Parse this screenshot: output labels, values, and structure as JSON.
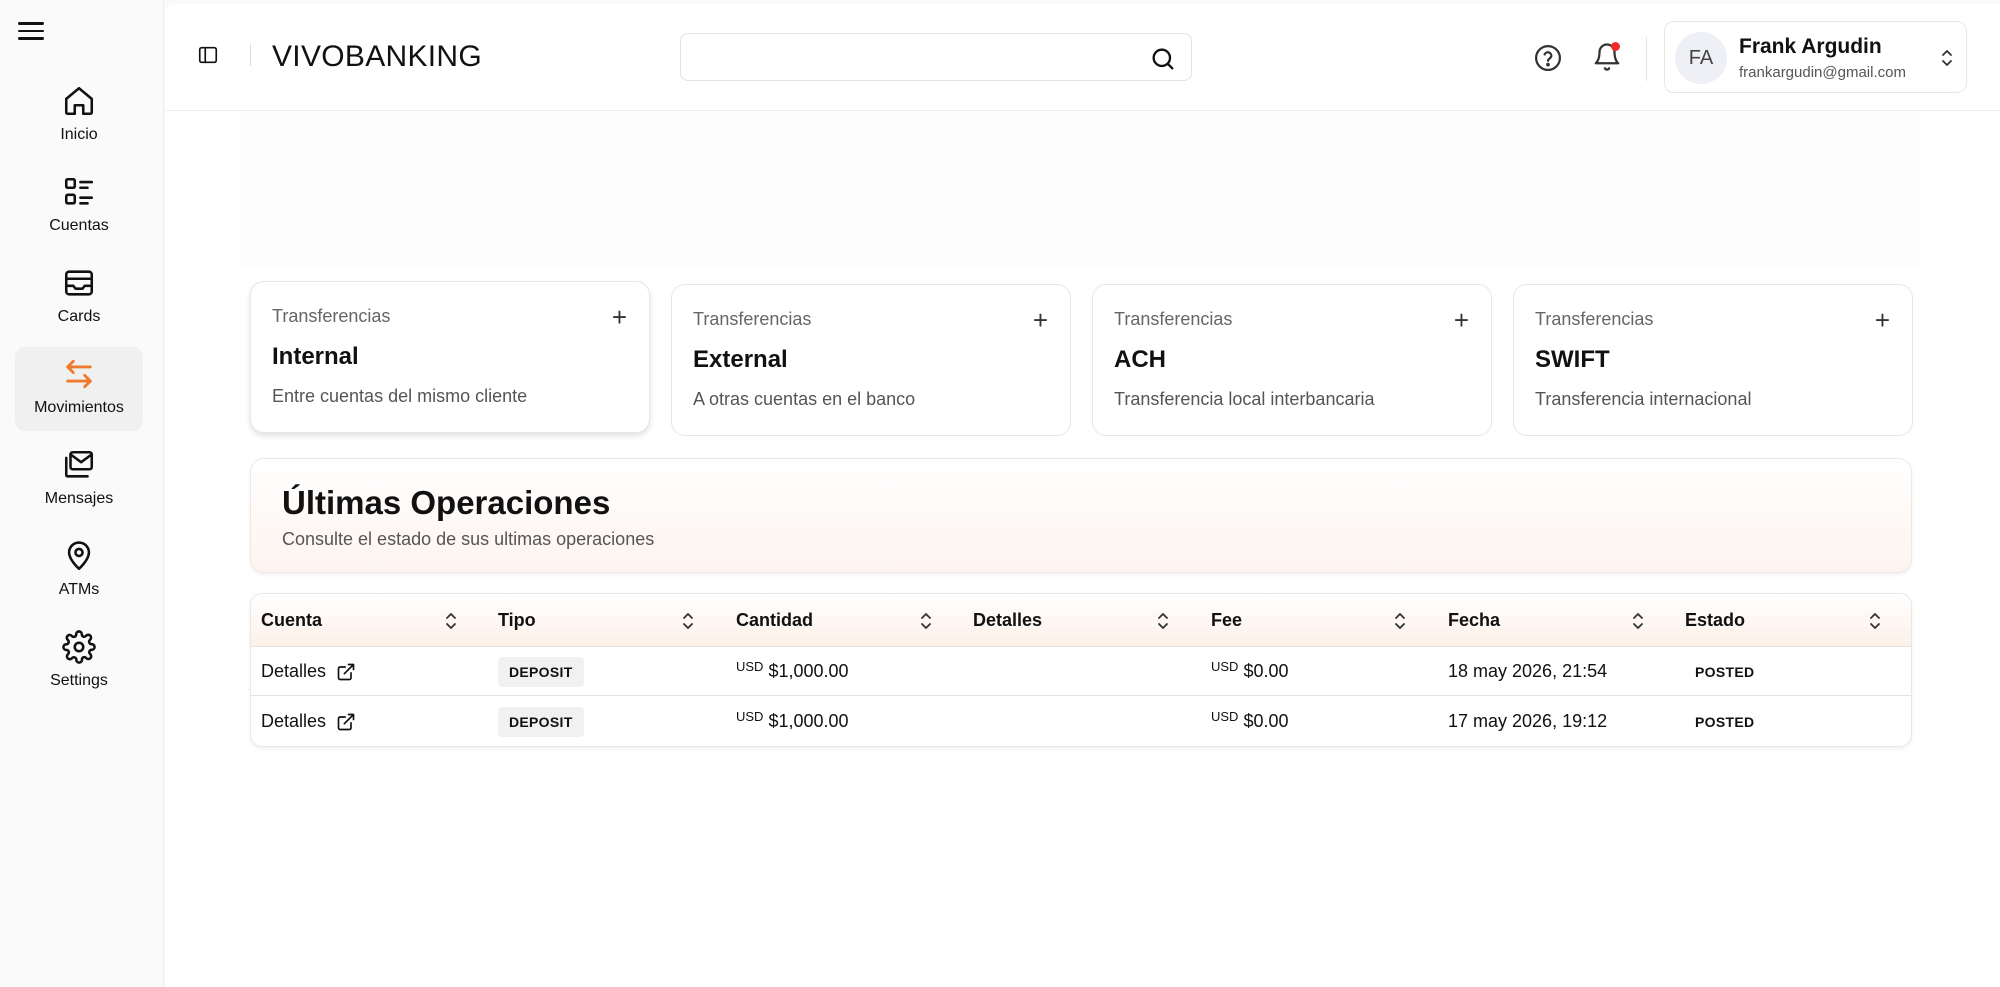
{
  "sidebar": {
    "items": [
      {
        "label": "Inicio",
        "icon": "home-icon"
      },
      {
        "label": "Cuentas",
        "icon": "list-icon"
      },
      {
        "label": "Cards",
        "icon": "card-icon"
      },
      {
        "label": "Movimientos",
        "icon": "transfer-arrows-icon",
        "active": true
      },
      {
        "label": "Mensajes",
        "icon": "messages-icon"
      },
      {
        "label": "ATMs",
        "icon": "map-pin-icon"
      },
      {
        "label": "Settings",
        "icon": "gear-icon"
      }
    ]
  },
  "header": {
    "brand": "VIVOBANKING",
    "search": {
      "value": "",
      "placeholder": ""
    },
    "notification_dot_color": "#ef2b2b",
    "user": {
      "initials": "FA",
      "name": "Frank Argudin",
      "email": "frankargudin@gmail.com"
    }
  },
  "transfers": [
    {
      "category": "Transferencias",
      "title": "Internal",
      "description": "Entre cuentas del mismo cliente"
    },
    {
      "category": "Transferencias",
      "title": "External",
      "description": "A otras cuentas en el banco"
    },
    {
      "category": "Transferencias",
      "title": "ACH",
      "description": "Transferencia local interbancaria"
    },
    {
      "category": "Transferencias",
      "title": "SWIFT",
      "description": "Transferencia internacional"
    }
  ],
  "operations": {
    "title": "Últimas Operaciones",
    "subtitle": "Consulte el estado de sus ultimas operaciones"
  },
  "table": {
    "columns": [
      "Cuenta",
      "Tipo",
      "Cantidad",
      "Detalles",
      "Fee",
      "Fecha",
      "Estado"
    ],
    "rows": [
      {
        "cuenta": "Detalles",
        "tipo": "DEPOSIT",
        "currency": "USD",
        "cantidad": "$1,000.00",
        "detalles": "",
        "fee_currency": "USD",
        "fee": "$0.00",
        "fecha": "18 may 2026, 21:54",
        "estado": "POSTED"
      },
      {
        "cuenta": "Detalles",
        "tipo": "DEPOSIT",
        "currency": "USD",
        "cantidad": "$1,000.00",
        "detalles": "",
        "fee_currency": "USD",
        "fee": "$0.00",
        "fecha": "17 may 2026, 19:12",
        "estado": "POSTED"
      }
    ]
  },
  "colors": {
    "accent": "#f07a2c",
    "header_gradient_end": "#fdf0e8"
  }
}
